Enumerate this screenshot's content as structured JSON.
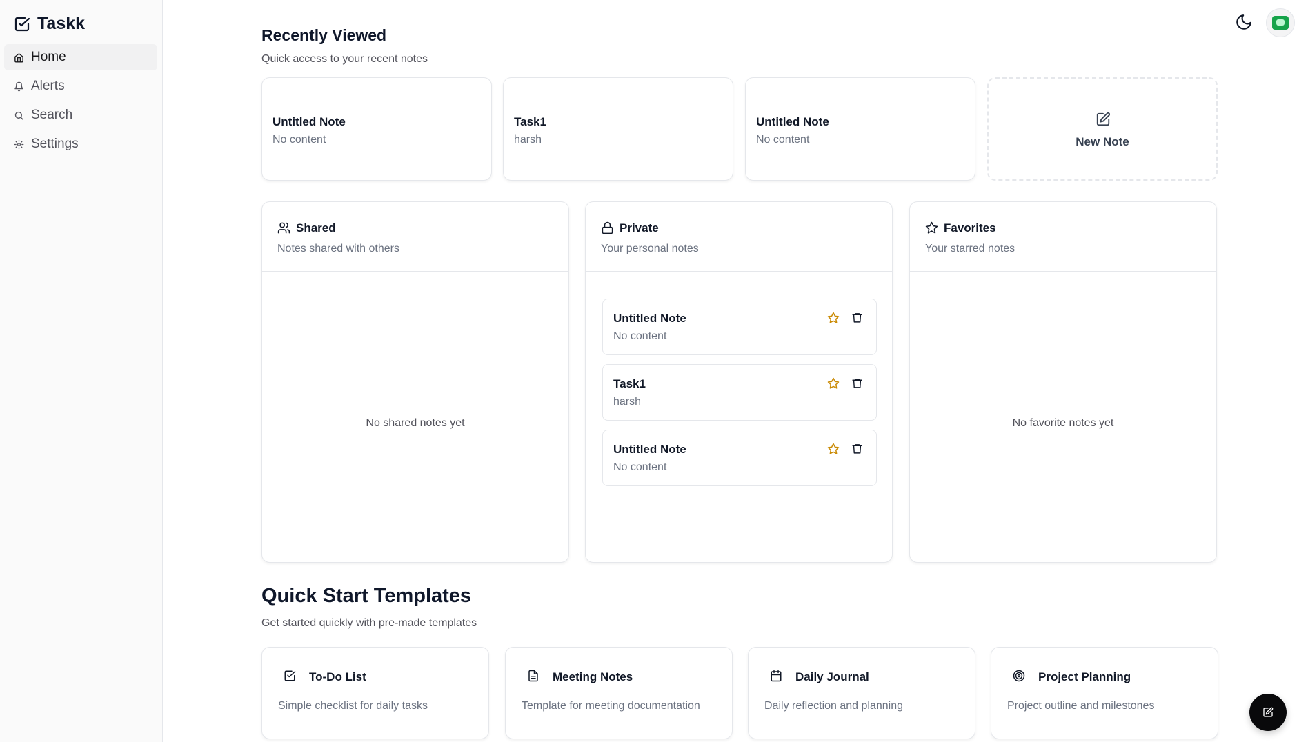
{
  "app": {
    "name": "Taskk"
  },
  "sidebar": {
    "items": [
      {
        "label": "Home",
        "icon": "home-icon",
        "active": true
      },
      {
        "label": "Alerts",
        "icon": "bell-icon",
        "active": false
      },
      {
        "label": "Search",
        "icon": "search-icon",
        "active": false
      },
      {
        "label": "Settings",
        "icon": "gear-icon",
        "active": false
      }
    ]
  },
  "recent": {
    "title": "Recently Viewed",
    "subtitle": "Quick access to your recent notes",
    "cards": [
      {
        "title": "Untitled Note",
        "text": "No content"
      },
      {
        "title": "Task1",
        "text": "harsh"
      },
      {
        "title": "Untitled Note",
        "text": "No content"
      }
    ],
    "new_note_label": "New Note"
  },
  "panels": {
    "shared": {
      "title": "Shared",
      "subtitle": "Notes shared with others",
      "empty": "No shared notes yet"
    },
    "private": {
      "title": "Private",
      "subtitle": "Your personal notes",
      "notes": [
        {
          "title": "Untitled Note",
          "text": "No content"
        },
        {
          "title": "Task1",
          "text": "harsh"
        },
        {
          "title": "Untitled Note",
          "text": "No content"
        }
      ]
    },
    "favorites": {
      "title": "Favorites",
      "subtitle": "Your starred notes",
      "empty": "No favorite notes yet"
    }
  },
  "templates": {
    "title": "Quick Start Templates",
    "subtitle": "Get started quickly with pre-made templates",
    "items": [
      {
        "title": "To-Do List",
        "desc": "Simple checklist for daily tasks",
        "icon": "checkbox-icon"
      },
      {
        "title": "Meeting Notes",
        "desc": "Template for meeting documentation",
        "icon": "document-icon"
      },
      {
        "title": "Daily Journal",
        "desc": "Daily reflection and planning",
        "icon": "calendar-icon"
      },
      {
        "title": "Project Planning",
        "desc": "Project outline and milestones",
        "icon": "target-icon"
      }
    ]
  },
  "colors": {
    "star": "#ca8a04",
    "text": "#0f172a",
    "muted": "#6b7280",
    "border": "#e5e7eb",
    "avatar": "#16a34a"
  }
}
